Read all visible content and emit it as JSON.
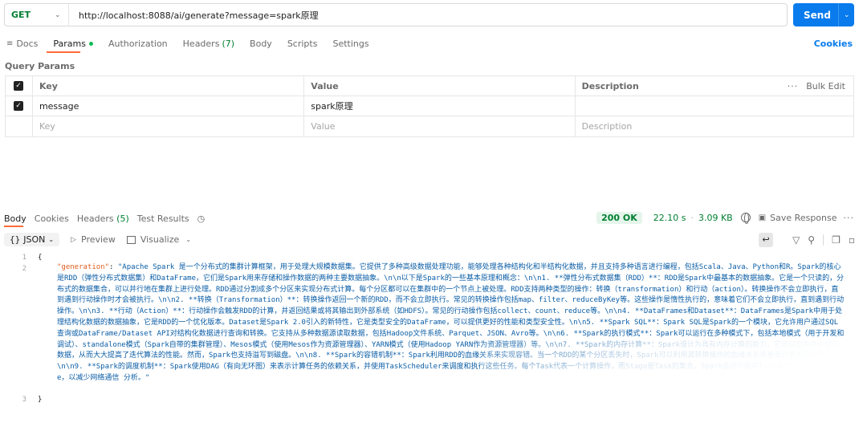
{
  "request": {
    "method": "GET",
    "url": "http://localhost:8088/ai/generate?message=spark原理",
    "send_label": "Send"
  },
  "request_tabs": [
    {
      "label": "Docs"
    },
    {
      "label": "Params"
    },
    {
      "label": "Authorization"
    },
    {
      "label": "Headers",
      "count": "(7)"
    },
    {
      "label": "Body"
    },
    {
      "label": "Scripts"
    },
    {
      "label": "Settings"
    }
  ],
  "cookies_label": "Cookies",
  "query_params_title": "Query Params",
  "params_table": {
    "headers": {
      "key": "Key",
      "value": "Value",
      "description": "Description",
      "bulk_edit": "Bulk Edit"
    },
    "rows": [
      {
        "key": "message",
        "value": "spark原理",
        "description": "",
        "checked": true
      }
    ],
    "placeholders": {
      "key": "Key",
      "value": "Value",
      "description": "Description"
    }
  },
  "response_tabs": [
    {
      "label": "Body"
    },
    {
      "label": "Cookies"
    },
    {
      "label": "Headers",
      "count": "(5)"
    },
    {
      "label": "Test Results"
    }
  ],
  "response_meta": {
    "status": "200 OK",
    "time": "22.10 s",
    "size": "3.09 KB",
    "save_label": "Save Response"
  },
  "format_bar": {
    "format": "JSON",
    "preview": "Preview",
    "visualize": "Visualize"
  },
  "code": {
    "line_numbers": [
      "1",
      "2",
      "3"
    ],
    "open_brace": "{",
    "close_brace": "}",
    "key": "\"generation\"",
    "colon": ": ",
    "value": "\"Apache Spark 是一个分布式的集群计算框架，用于处理大规模数据集。它提供了多种高级数据处理功能，能够处理各种结构化和半结构化数据，并且支持多种语言进行编程，包括Scala、Java、Python和R。Spark的核心是RDD（弹性分布式数据集）和DataFrame，它们是Spark用来存储和操作数据的两种主要数据抽象。\\n\\n以下是Spark的一些基本原理和概念：\\n\\n1. **弹性分布式数据集（RDD）**：RDD是Spark中最基本的数据抽象。它是一个只读的，分布式的数据集合，可以并行地在集群上进行处理。RDD通过分割成多个分区来实现分布式计算。每个分区都可以在集群中的一个节点上被处理。RDD支持两种类型的操作：转换（transformation）和行动（action）。转换操作不会立即执行，直到遇到行动操作时才会被执行。\\n\\n2. **转换（Transformation）**：转换操作返回一个新的RDD，而不会立即执行。常见的转换操作包括map、filter、reduceByKey等。这些操作是惰性执行的，意味着它们不会立即执行，直到遇到行动操作。\\n\\n3. **行动（Action）**：行动操作会触发RDD的计算，并返回结果或将其输出到外部系统（如HDFS）。常见的行动操作包括collect、count、reduce等。\\n\\n4. **DataFrames和Dataset**：DataFrames是Spark中用于处理结构化数据的数据抽象，它是RDD的一个优化版本。Dataset是Spark 2.0引入的新特性，它是类型安全的DataFrame，可以提供更好的性能和类型安全性。\\n\\n5. **Spark SQL**：Spark SQL是Spark的一个模块，它允许用户通过SQL查询或DataFrame/Dataset API对结构化数据进行查询和转换。它支持从多种数据源读取数据，包括Hadoop文件系统、Parquet、JSON、Avro等。\\n\\n6. **Spark的执行模式**：Spark可以运行在多种模式下，包括本地模式（用于开发和调试）、standalone模式（Spark自带的集群管理）、Mesos模式（使用Mesos作为资源管理器）、YARN模式（使用Hadoop YARN作为资源管理器）等。\\n\\n7. **Spark的内存计算**：Spark设计为具有内存计算的能力，它可以在内存中缓存数据，从而大大提高了迭代算法的性能。然而，Spark也支持溢写到磁盘。\\n\\n8. **Spark的容错机制**：Spark利用RDD的血缘关系来实现容错。当一个RDD的某个分区丢失时，Spark可以利用其转换操作的血缘关系来重新计算丢失的数据。\\n\\n9. **Spark的调度机制**：Spark使用DAG（有向无环图）来表示计算任务的依赖关系，并使用TaskScheduler来调度和执行这些任务。每个Task代表一个计算操作，而Stage是Task的集合，Spark会尽可能将Task组织在一起形成Stage，以减少网络通信\",\n    \"分析。\"",
    "value_tail": "分析。\""
  },
  "colors": {
    "accent": "#ff6c37",
    "primary": "#097bed",
    "success": "#007f31",
    "json_key": "#e25e1c",
    "json_string": "#0a5da6"
  }
}
